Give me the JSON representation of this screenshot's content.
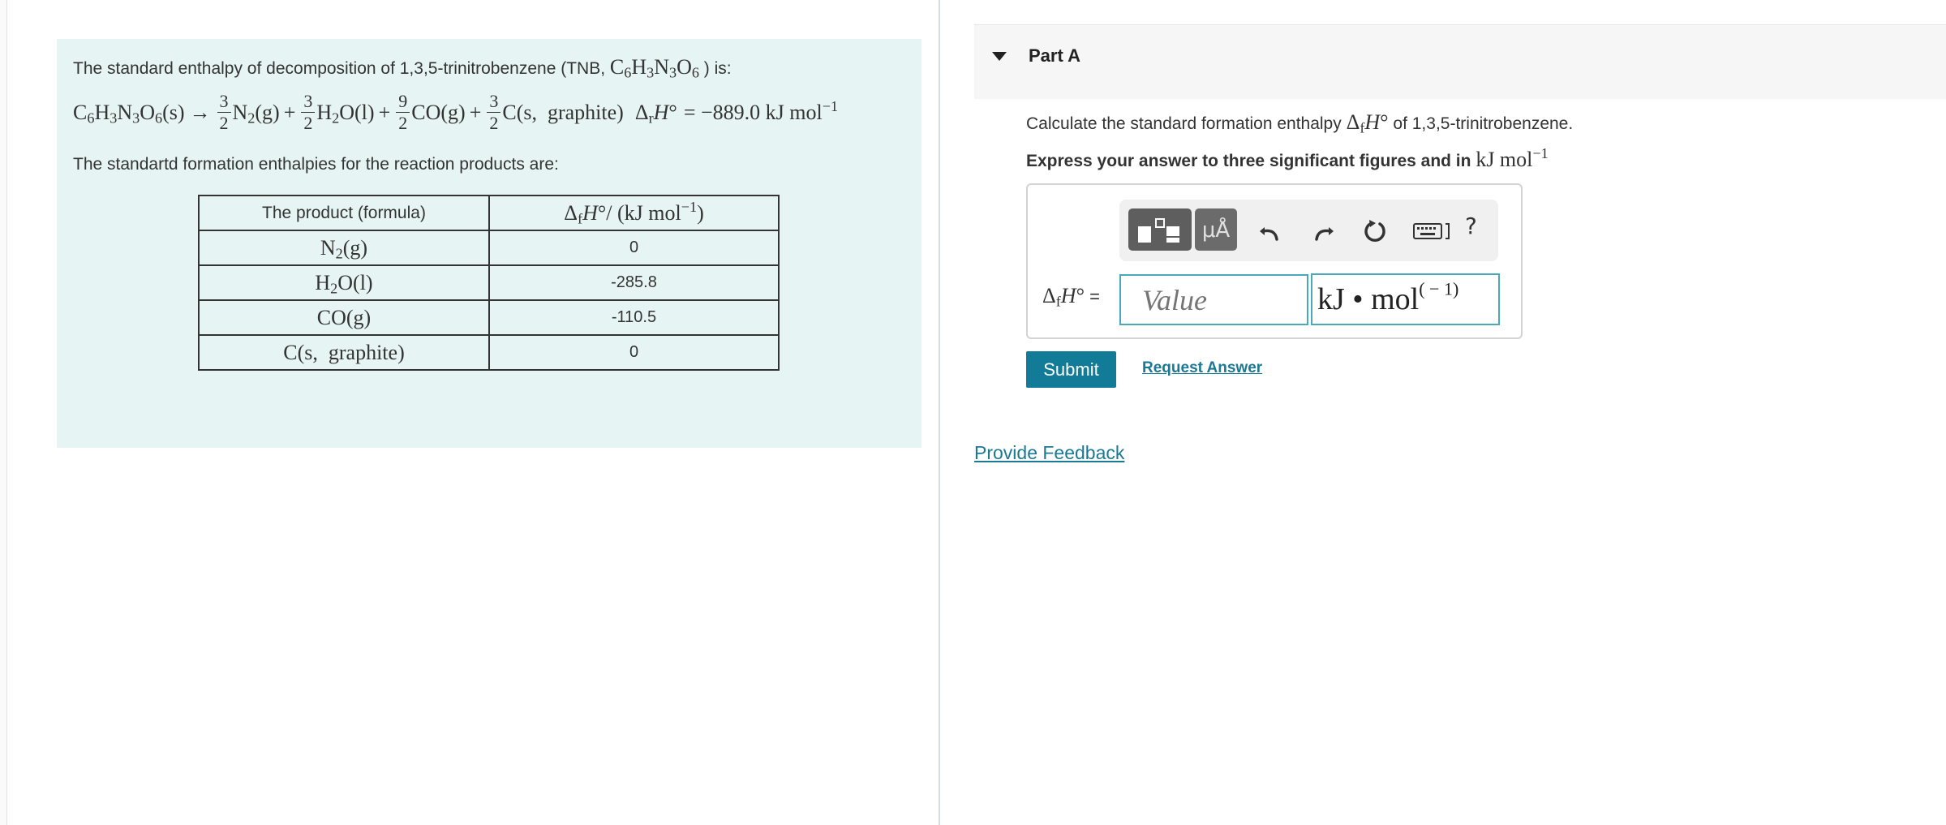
{
  "problem": {
    "intro_text": "The standard enthalpy of decomposition of 1,3,5-trinitrobenzene (TNB, ",
    "intro_formula": "C6H3N3O6",
    "intro_suffix": " ) is:",
    "equation": {
      "reactant": "C6H3N3O6(s)",
      "arrow": "→",
      "coef_n2": [
        "3",
        "2"
      ],
      "n2": "N2(g)",
      "coef_h2o": [
        "3",
        "2"
      ],
      "h2o": "H2O(l)",
      "coef_co": [
        "9",
        "2"
      ],
      "co": "CO(g)",
      "coef_c": [
        "3",
        "2"
      ],
      "c": "C(s,  graphite)",
      "delta_label": "ΔrH°",
      "delta_value": "= −889.0 kJ mol−1"
    },
    "products_label": "The standartd formation enthalpies for the reaction products are:",
    "table": {
      "headers": [
        "The product (formula)",
        "ΔfH°/ (kJ mol−1)"
      ],
      "rows": [
        {
          "formula": "N2(g)",
          "value": "0"
        },
        {
          "formula": "H2O(l)",
          "value": "-285.8"
        },
        {
          "formula": "CO(g)",
          "value": "-110.5"
        },
        {
          "formula": "C(s,  graphite)",
          "value": "0"
        }
      ]
    }
  },
  "part": {
    "title": "Part A",
    "question_prefix": "Calculate the standard formation enthalpy ",
    "question_symbol": "ΔfH°",
    "question_suffix": " of 1,3,5-trinitrobenzene.",
    "instruction_prefix": "Express your answer to three significant figures and in ",
    "instruction_units": "kJ mol−1",
    "lhs_symbol": "ΔfH°",
    "lhs_equals": " =",
    "value_placeholder": "Value",
    "units_text": "kJ • mol",
    "units_sup": "( − 1)",
    "toolbar": {
      "units_button": "μÅ",
      "help": "?"
    },
    "submit_label": "Submit",
    "request_answer_label": "Request Answer"
  },
  "feedback_label": "Provide Feedback",
  "colors": {
    "panel_bg": "#e6f5f4",
    "accent": "#127c98",
    "link": "#1a7a96",
    "input_border": "#4aa9b8"
  }
}
